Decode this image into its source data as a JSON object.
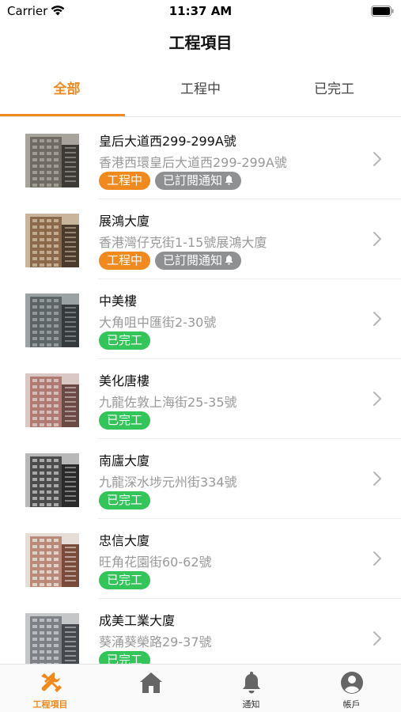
{
  "status_bar": {
    "carrier": "Carrier",
    "time": "11:37 AM"
  },
  "header": {
    "title": "工程項目"
  },
  "tabs": [
    {
      "label": "全部",
      "active": true
    },
    {
      "label": "工程中",
      "active": false
    },
    {
      "label": "已完工",
      "active": false
    }
  ],
  "projects": [
    {
      "name": "皇后大道西299-299A號",
      "address": "香港西環皇后大道西299-299A號",
      "status": "工程中",
      "status_color": "#f08a1f",
      "subscription": "已訂閱通知",
      "thumb_colors": [
        "#6f6a62",
        "#a8a49c",
        "#3d3a35"
      ]
    },
    {
      "name": "展鴻大廈",
      "address": "香港灣仔克街1-15號展鴻大廈",
      "status": "工程中",
      "status_color": "#f08a1f",
      "subscription": "已訂閱通知",
      "thumb_colors": [
        "#8a6a4a",
        "#c9b59c",
        "#4a3b2c"
      ]
    },
    {
      "name": "中美樓",
      "address": "大角咀中匯街2-30號",
      "status": "已完工",
      "status_color": "#33c45a",
      "subscription": "",
      "thumb_colors": [
        "#5d6466",
        "#9aa2a4",
        "#353a3c"
      ]
    },
    {
      "name": "美化唐樓",
      "address": "九龍佐敦上海街25-35號",
      "status": "已完工",
      "status_color": "#33c45a",
      "subscription": "",
      "thumb_colors": [
        "#b07a72",
        "#d9c8c4",
        "#6b4a45"
      ]
    },
    {
      "name": "南廬大廈",
      "address": "九龍深水埗元州街334號",
      "status": "已完工",
      "status_color": "#33c45a",
      "subscription": "",
      "thumb_colors": [
        "#4c4c4c",
        "#b8b8b8",
        "#2a2a2a"
      ]
    },
    {
      "name": "忠信大廈",
      "address": "旺角花園街60-62號",
      "status": "已完工",
      "status_color": "#33c45a",
      "subscription": "",
      "thumb_colors": [
        "#b98a78",
        "#e6ddd6",
        "#7a4a3a"
      ]
    },
    {
      "name": "成美工業大廈",
      "address": "葵涌葵榮路29-37號",
      "status": "已完工",
      "status_color": "#33c45a",
      "subscription": "",
      "thumb_colors": [
        "#7d8084",
        "#c4c6c8",
        "#45484c"
      ]
    }
  ],
  "tabbar": [
    {
      "label": "工程項目",
      "icon": "tools-icon",
      "active": true
    },
    {
      "label": "",
      "icon": "home-icon",
      "active": false
    },
    {
      "label": "通知",
      "icon": "bell-icon",
      "active": false
    },
    {
      "label": "帳戶",
      "icon": "account-icon",
      "active": false
    }
  ],
  "colors": {
    "accent": "#f08a1f",
    "done": "#33c45a",
    "subscribed": "#8f9092"
  }
}
